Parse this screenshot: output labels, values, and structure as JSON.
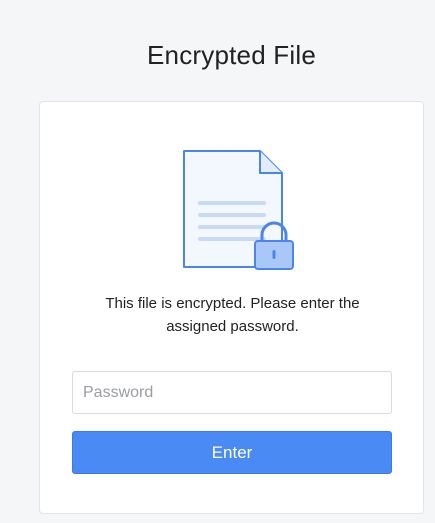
{
  "header": {
    "title": "Encrypted File"
  },
  "card": {
    "icon": "encrypted-document-icon",
    "message_line1": "This file is encrypted. Please enter the",
    "message_line2": "assigned password.",
    "password_placeholder": "Password",
    "password_value": "",
    "enter_label": "Enter"
  },
  "colors": {
    "accent": "#4a8af4",
    "icon_stroke": "#4a86e8",
    "icon_fill": "#e9f1fd",
    "lock_fill": "#a9c7f7"
  }
}
